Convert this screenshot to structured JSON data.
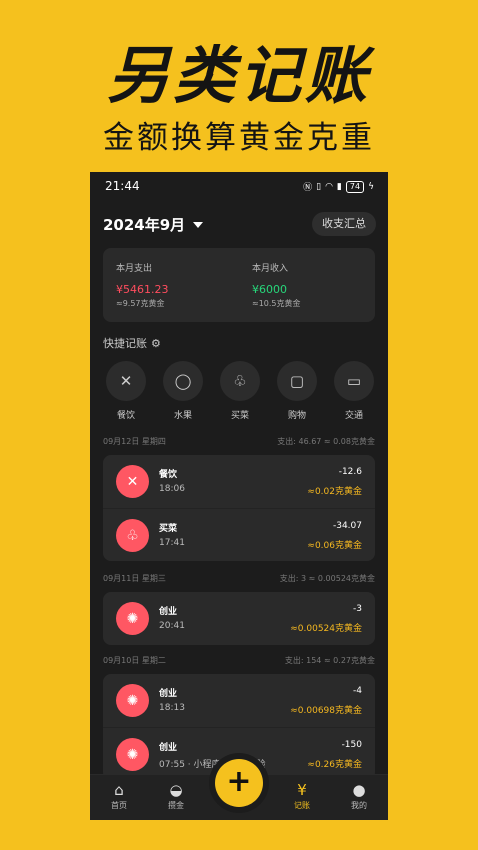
{
  "promo": {
    "title": "另类记账",
    "subtitle": "金额换算黄金克重"
  },
  "status_bar": {
    "time": "21:44",
    "icons": [
      "nfc-icon",
      "vibrate-icon",
      "wifi-icon",
      "sim-icon"
    ],
    "battery": "74"
  },
  "header": {
    "month": "2024年9月",
    "summary_button": "收支汇总"
  },
  "stats": {
    "expense_label": "本月支出",
    "expense_value": "¥5461.23",
    "expense_gold": "≈9.57克黄金",
    "income_label": "本月收入",
    "income_value": "¥6000",
    "income_gold": "≈10.5克黄金",
    "expense_color": "#ff4d5e",
    "income_color": "#27d67a"
  },
  "quick": {
    "title": "快捷记账",
    "items": [
      {
        "label": "餐饮",
        "icon": "utensils-icon"
      },
      {
        "label": "水果",
        "icon": "apple-icon"
      },
      {
        "label": "买菜",
        "icon": "vegetable-icon"
      },
      {
        "label": "购物",
        "icon": "shopping-bag-icon"
      },
      {
        "label": "交通",
        "icon": "bus-icon"
      }
    ]
  },
  "days": [
    {
      "date": "09月12日 星期四",
      "summary": "支出: 46.67 ≈ 0.08克黄金",
      "entries": [
        {
          "category": "餐饮",
          "time": "18:06",
          "amount": "-12.6",
          "gold": "≈0.02克黄金",
          "icon": "utensils-icon"
        },
        {
          "category": "买菜",
          "time": "17:41",
          "amount": "-34.07",
          "gold": "≈0.06克黄金",
          "icon": "vegetable-icon"
        }
      ]
    },
    {
      "date": "09月11日 星期三",
      "summary": "支出: 3 ≈ 0.00524克黄金",
      "entries": [
        {
          "category": "创业",
          "time": "20:41",
          "amount": "-3",
          "gold": "≈0.00524克黄金",
          "icon": "lightbulb-icon"
        }
      ]
    },
    {
      "date": "09月10日 星期二",
      "summary": "支出: 154 ≈ 0.27克黄金",
      "entries": [
        {
          "category": "创业",
          "time": "18:13",
          "amount": "-4",
          "gold": "≈0.00698克黄金",
          "icon": "lightbulb-icon"
        },
        {
          "category": "创业",
          "time": "07:55 · 小程序手续费收验",
          "amount": "-150",
          "gold": "≈0.26克黄金",
          "icon": "lightbulb-icon"
        }
      ]
    }
  ],
  "tabs": [
    {
      "label": "首页",
      "icon": "home-icon"
    },
    {
      "label": "攒金",
      "icon": "money-bag-icon"
    },
    {
      "label": "记账",
      "icon": "ledger-icon",
      "active": true
    },
    {
      "label": "我的",
      "icon": "user-icon"
    }
  ],
  "fab": {
    "label": "+"
  },
  "accent_color": "#f5c11e",
  "gold_color": "#f5b820"
}
